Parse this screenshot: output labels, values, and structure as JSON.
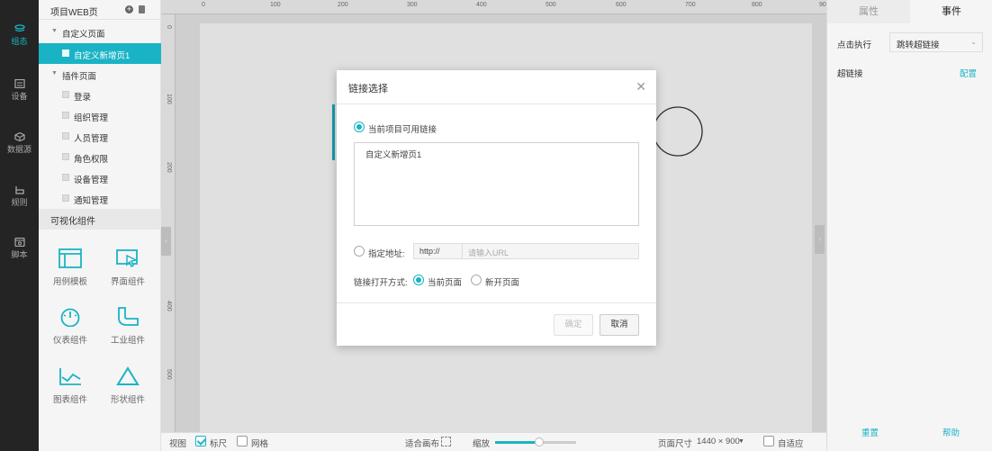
{
  "nav": {
    "items": [
      {
        "label": "组态",
        "icon": "layers-icon",
        "active": true
      },
      {
        "label": "设备",
        "icon": "device-icon",
        "active": false
      },
      {
        "label": "数据源",
        "icon": "cube-icon",
        "active": false
      },
      {
        "label": "规则",
        "icon": "rule-icon",
        "active": false
      },
      {
        "label": "脚本",
        "icon": "script-icon",
        "active": false
      }
    ]
  },
  "sidebar": {
    "title": "项目WEB页",
    "group1": "自定义页面",
    "custom_pages": [
      "自定义新增页1"
    ],
    "group2": "插件页面",
    "plugin_pages": [
      "登录",
      "组织管理",
      "人员管理",
      "角色权限",
      "设备管理",
      "通知管理"
    ],
    "components_title": "可视化组件",
    "components": [
      "用例模板",
      "界面组件",
      "仪表组件",
      "工业组件",
      "图表组件",
      "形状组件"
    ]
  },
  "ruler": {
    "top": [
      "0",
      "100",
      "200",
      "300",
      "400",
      "500",
      "600",
      "700",
      "800",
      "90"
    ],
    "left": [
      "0",
      "100",
      "200",
      "400",
      "500"
    ]
  },
  "bottom": {
    "view": "视图",
    "ruler": "标尺",
    "grid": "网格",
    "fit": "适合画布",
    "zoom": "缩放",
    "page_size_label": "页面尺寸",
    "page_size": "1440 × 900",
    "auto": "自适应"
  },
  "right": {
    "tab_props": "属性",
    "tab_events": "事件",
    "click_label": "点击执行",
    "click_value": "跳转超链接",
    "link_label": "超链接",
    "config": "配置",
    "reset": "重置",
    "help": "帮助"
  },
  "modal": {
    "title": "链接选择",
    "opt_current": "当前项目可用链接",
    "links": [
      "自定义新增页1"
    ],
    "opt_custom": "指定地址:",
    "protocol": "http://",
    "url_placeholder": "请输入URL",
    "open_label": "链接打开方式:",
    "open_current": "当前页面",
    "open_new": "新开页面",
    "ok": "确定",
    "cancel": "取消"
  },
  "colors": {
    "accent": "#1ab3c5",
    "nav_bg": "#242424"
  }
}
